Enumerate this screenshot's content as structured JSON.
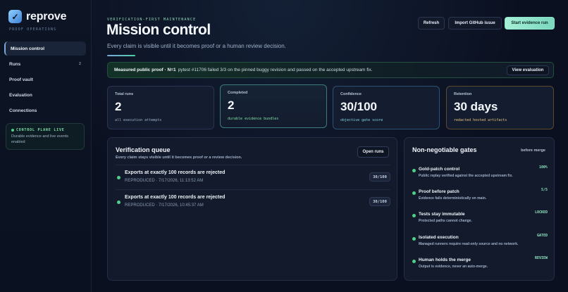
{
  "brand": {
    "name": "reprove",
    "subtitle": "PROOF OPERATIONS",
    "logo_icon": "check-icon"
  },
  "sidebar": {
    "items": [
      {
        "label": "Mission control",
        "badge": ""
      },
      {
        "label": "Runs",
        "badge": "2"
      },
      {
        "label": "Proof vault",
        "badge": ""
      },
      {
        "label": "Evaluation",
        "badge": ""
      },
      {
        "label": "Connections",
        "badge": ""
      }
    ],
    "status": {
      "title": "CONTROL PLANE LIVE",
      "text": "Durable evidence and live events enabled"
    }
  },
  "header": {
    "eyebrow": "VERIFICATION-FIRST MAINTENANCE",
    "title": "Mission control",
    "subtitle": "Every claim is visible until it becomes proof or a human review decision.",
    "buttons": {
      "refresh": "Refresh",
      "import": "Import GitHub issue",
      "start": "Start evidence run"
    }
  },
  "banner": {
    "strong": "Measured public proof · N=1",
    "text": "pytest #11706 failed 3/3 on the pinned buggy revision and passed on the accepted upstream fix.",
    "button": "View evaluation"
  },
  "stats": [
    {
      "label": "Total runs",
      "value": "2",
      "foot": "all execution attempts"
    },
    {
      "label": "Completed",
      "value": "2",
      "foot": "durable evidence bundles"
    },
    {
      "label": "Confidence",
      "value": "30/100",
      "foot": "objective gate score"
    },
    {
      "label": "Retention",
      "value": "30 days",
      "foot": "redacted hosted artifacts"
    }
  ],
  "queue": {
    "title": "Verification queue",
    "subtitle": "Every claim stays visible until it becomes proof or a review decision.",
    "open_button": "Open runs",
    "rows": [
      {
        "title": "Exports at exactly 100 records are rejected",
        "meta": "REPRODUCED · 7/17/2026, 11:13:52 AM",
        "score": "30/100"
      },
      {
        "title": "Exports at exactly 100 records are rejected",
        "meta": "REPRODUCED · 7/17/2026, 10:45:37 AM",
        "score": "30/100"
      }
    ]
  },
  "gates": {
    "title": "Non-negotiable gates",
    "note": "before merge",
    "items": [
      {
        "name": "Gold-patch control",
        "desc": "Public replay verified against the accepted upstream fix.",
        "tag": "100%"
      },
      {
        "name": "Proof before patch",
        "desc": "Evidence fails deterministically on main.",
        "tag": "5/5"
      },
      {
        "name": "Tests stay immutable",
        "desc": "Protected paths cannot change.",
        "tag": "LOCKED"
      },
      {
        "name": "Isolated execution",
        "desc": "Managed runners require read-only source and no network.",
        "tag": "GATED"
      },
      {
        "name": "Human holds the merge",
        "desc": "Output is evidence, never an auto-merge.",
        "tag": "REVIEW"
      }
    ]
  },
  "colors": {
    "accent": "#7ad7c0",
    "live": "#4fd08a",
    "background": "#0b1020"
  }
}
